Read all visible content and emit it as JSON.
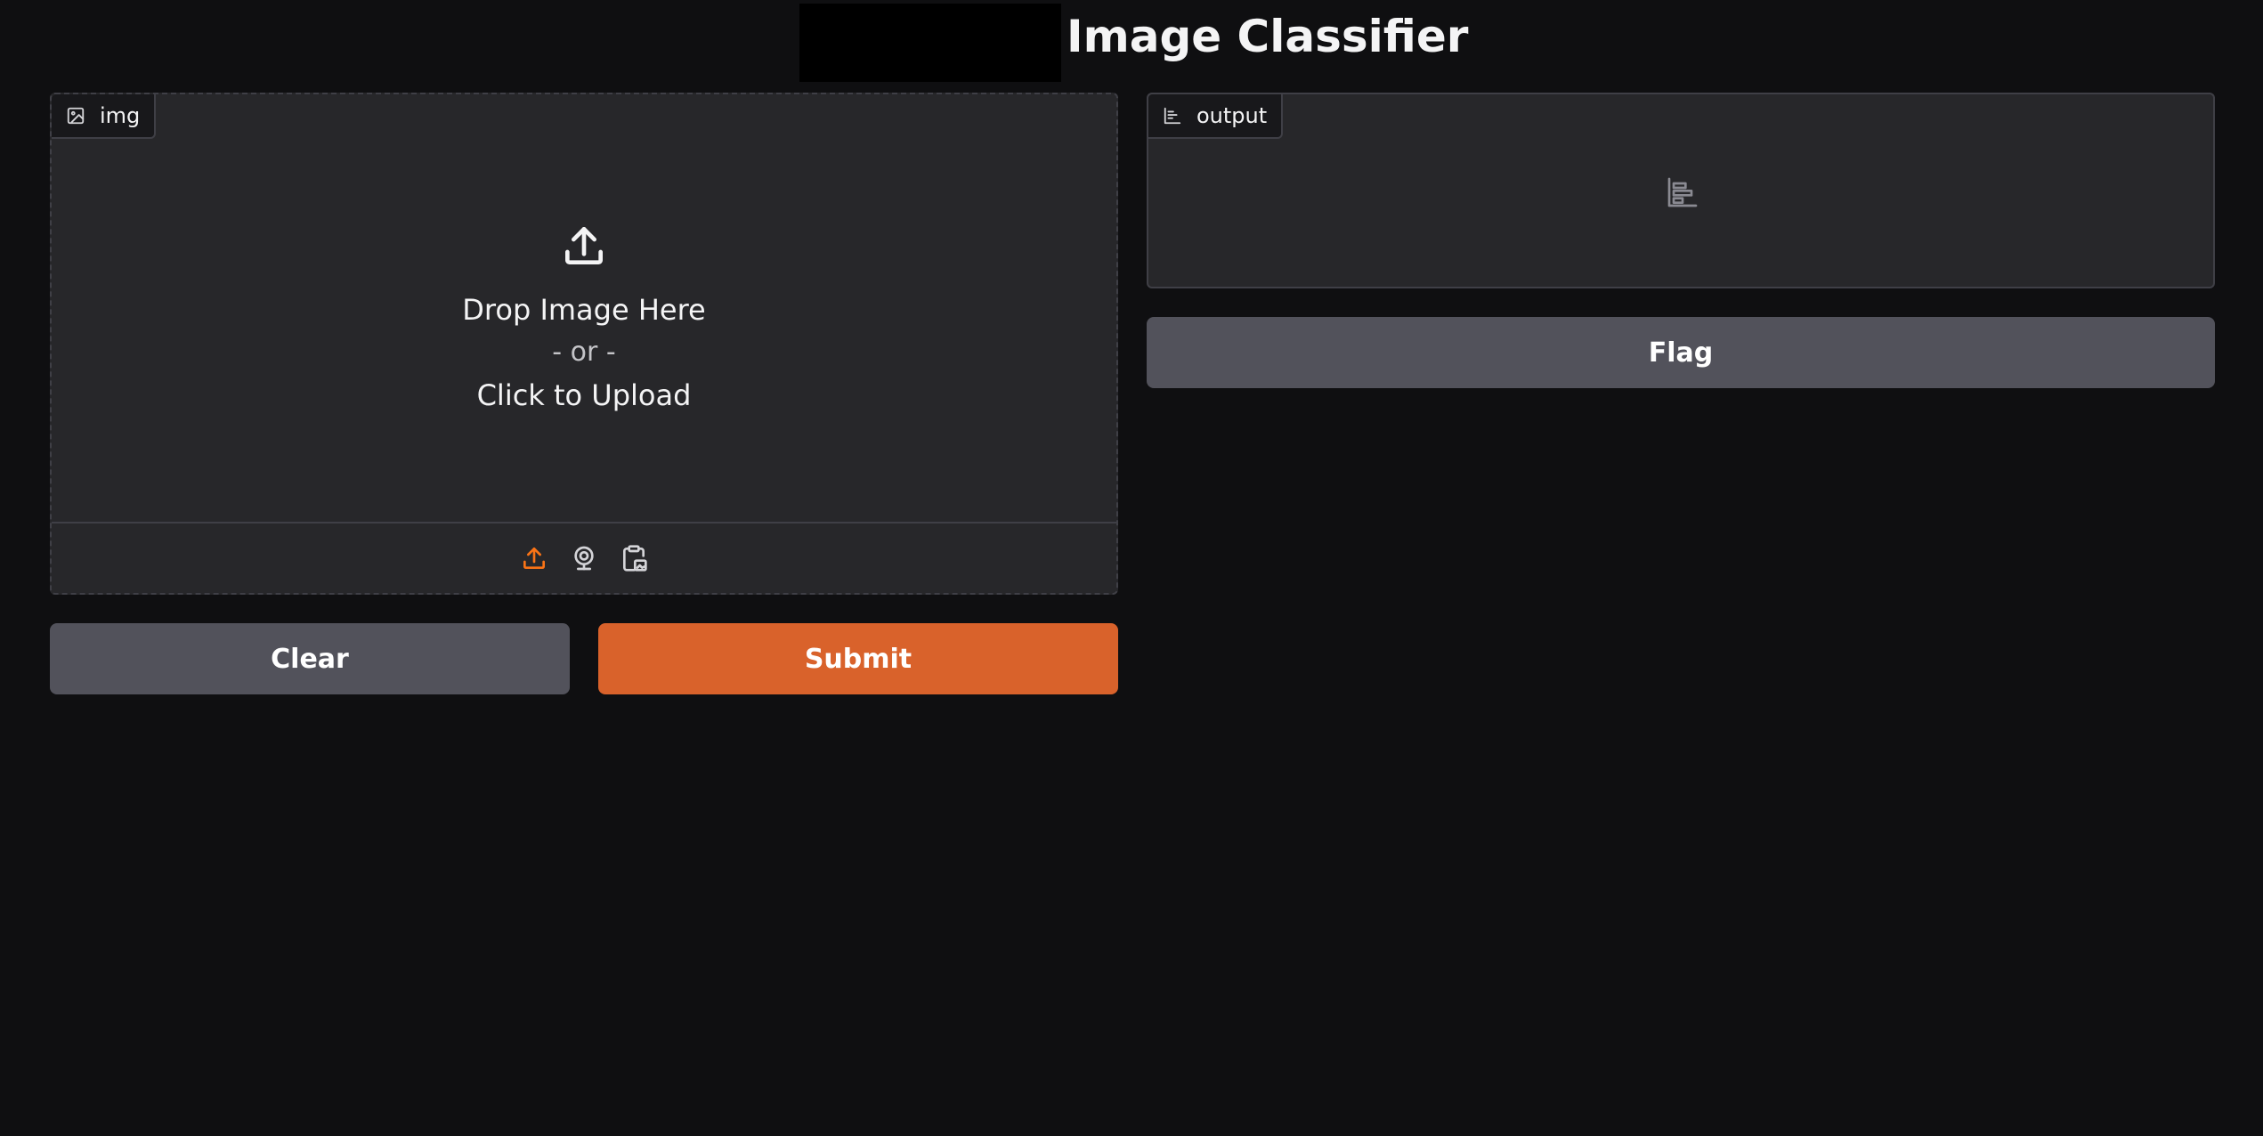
{
  "header": {
    "title": "Image Classifier"
  },
  "input_panel": {
    "label": "img",
    "label_icon": "image-icon",
    "drop_text": "Drop Image Here",
    "or_text": "- or -",
    "click_text": "Click to Upload",
    "sources": [
      {
        "name": "upload-source",
        "icon": "upload-icon",
        "active": true
      },
      {
        "name": "webcam-source",
        "icon": "webcam-icon",
        "active": false
      },
      {
        "name": "clipboard-source",
        "icon": "clipboard-icon",
        "active": false
      }
    ]
  },
  "output_panel": {
    "label": "output",
    "label_icon": "bar-chart-icon",
    "empty_icon": "bar-chart-icon"
  },
  "buttons": {
    "clear_label": "Clear",
    "submit_label": "Submit",
    "flag_label": "Flag"
  },
  "colors": {
    "background": "#0f0f11",
    "panel": "#27272a",
    "primary": "#d9622b",
    "secondary": "#52525b",
    "active_icon": "#f97316"
  }
}
